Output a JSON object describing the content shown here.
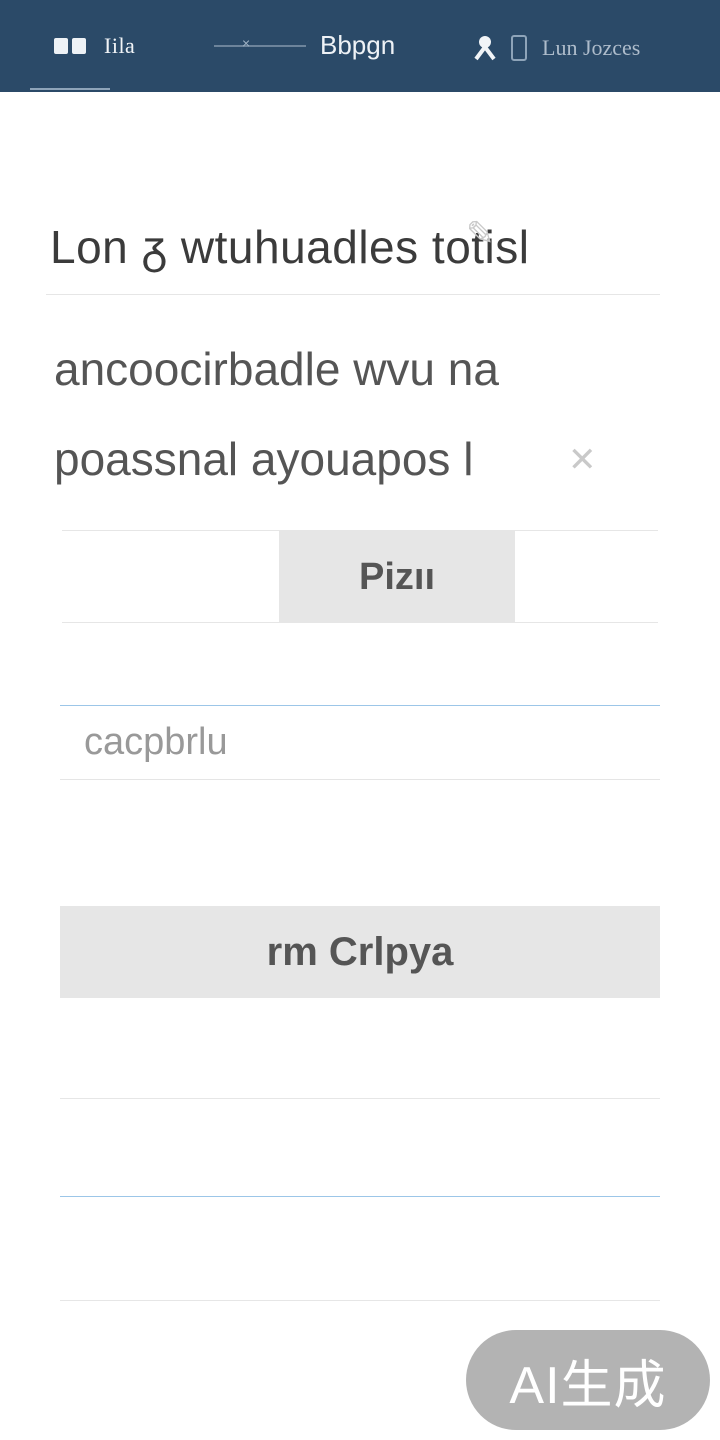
{
  "nav": {
    "tab_home_label": "Iila",
    "tab_search_label": "Bbpgn",
    "user_name": "Lun Jozces",
    "active_tab_color": "#8ea4b9",
    "bar_color": "#2b4a68"
  },
  "content": {
    "headline": "Lon ᵹ wtuhuadles totisl",
    "description_line1": "ancoocirbadle wvu na",
    "description_line2": "poassnal ayouapos l"
  },
  "actions": {
    "primary_label": "Pizıı",
    "input_value": "cacpbrlu",
    "secondary_label": "rm Crlpya"
  },
  "watermark": "AI生成",
  "accent_color": "#9cc6e8"
}
